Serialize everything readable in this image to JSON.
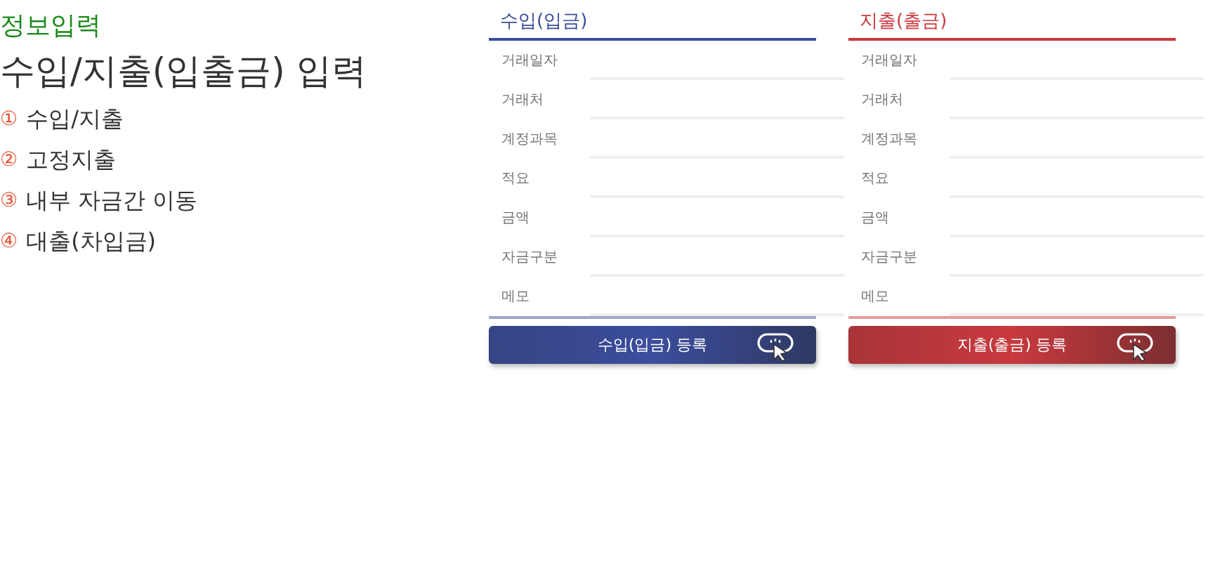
{
  "section_label": "정보입력",
  "heading": "수입/지출(입출금) 입력",
  "steps": [
    {
      "marker": "①",
      "label": "수입/지출"
    },
    {
      "marker": "②",
      "label": "고정지출"
    },
    {
      "marker": "③",
      "label": "내부 자금간 이동"
    },
    {
      "marker": "④",
      "label": "대출(차입금)"
    }
  ],
  "panels": [
    {
      "title": "수입(입금)",
      "color": "#3b4d9c",
      "fields": [
        "거래일자",
        "거래처",
        "계정과목",
        "적요",
        "금액",
        "자금구분",
        "메모"
      ],
      "button": "수입(입금) 등록"
    },
    {
      "title": "지출(출금)",
      "color": "#c9393e",
      "fields": [
        "거래일자",
        "거래처",
        "계정과목",
        "적요",
        "금액",
        "자금구분",
        "메모"
      ],
      "button": "지출(출금) 등록"
    }
  ]
}
